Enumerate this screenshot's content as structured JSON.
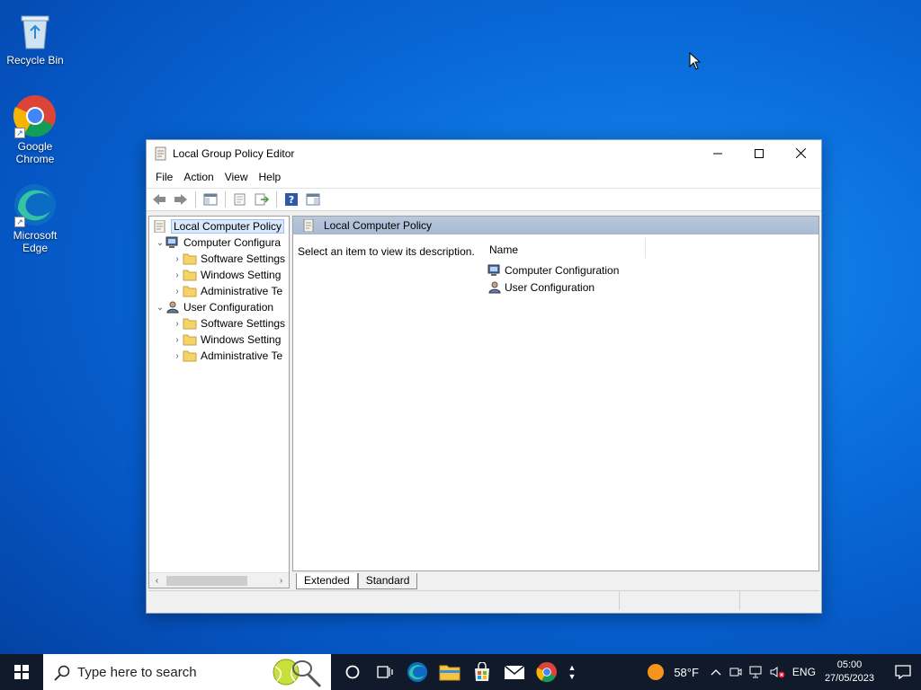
{
  "desktop": {
    "icons": [
      {
        "label": "Recycle Bin"
      },
      {
        "label": "Google\nChrome"
      },
      {
        "label": "Microsoft\nEdge"
      }
    ]
  },
  "window": {
    "title": "Local Group Policy Editor",
    "menu": [
      "File",
      "Action",
      "View",
      "Help"
    ],
    "tree": {
      "root": "Local Computer Policy",
      "computer_configuration": "Computer Configura",
      "cc_children": [
        "Software Settings",
        "Windows Setting",
        "Administrative Te"
      ],
      "user_configuration": "User Configuration",
      "uc_children": [
        "Software Settings",
        "Windows Setting",
        "Administrative Te"
      ]
    },
    "right_pane": {
      "header": "Local Computer Policy",
      "description": "Select an item to view its description.",
      "column_name": "Name",
      "items": [
        "Computer Configuration",
        "User Configuration"
      ]
    },
    "tabs": [
      "Extended",
      "Standard"
    ]
  },
  "taskbar": {
    "search_placeholder": "Type here to search",
    "weather": "58°F",
    "language": "ENG",
    "time": "05:00",
    "date": "27/05/2023"
  }
}
